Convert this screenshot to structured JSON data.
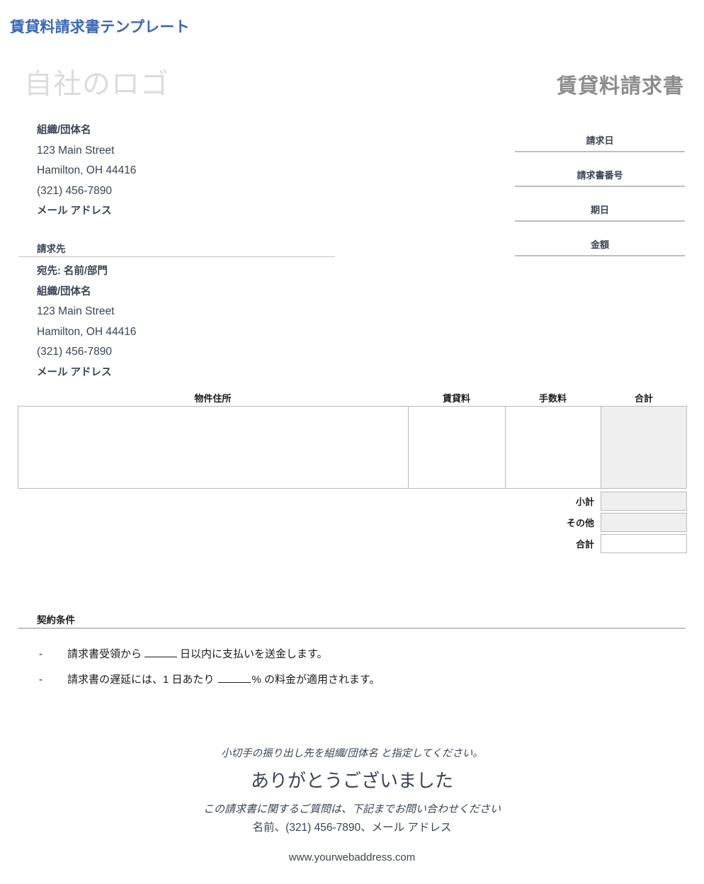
{
  "template_title": "賃貸料請求書テンプレート",
  "logo_placeholder": "自社のロゴ",
  "document_heading": "賃貸料請求書",
  "meta_fields": [
    {
      "label": "請求日",
      "value": ""
    },
    {
      "label": "請求書番号",
      "value": ""
    },
    {
      "label": "期日",
      "value": ""
    },
    {
      "label": "金額",
      "value": ""
    }
  ],
  "sender": {
    "lines": [
      {
        "text": "組織/団体名",
        "bold": true
      },
      {
        "text": "123 Main Street",
        "bold": false
      },
      {
        "text": "Hamilton, OH 44416",
        "bold": false
      },
      {
        "text": "(321) 456-7890",
        "bold": false
      },
      {
        "text": "メール アドレス",
        "bold": true
      }
    ]
  },
  "bill_to": {
    "heading": "請求先",
    "lines": [
      {
        "text": "宛先: 名前/部門",
        "bold": true
      },
      {
        "text": "組織/団体名",
        "bold": true
      },
      {
        "text": "123 Main Street",
        "bold": false
      },
      {
        "text": "Hamilton, OH 44416",
        "bold": false
      },
      {
        "text": "(321) 456-7890",
        "bold": false
      },
      {
        "text": "メール アドレス",
        "bold": true
      }
    ]
  },
  "items_table": {
    "columns": [
      "物件住所",
      "賃貸料",
      "手数料",
      "合計"
    ],
    "rows": [],
    "total_column_shaded_color": "#efefef"
  },
  "summary": [
    {
      "label": "小計",
      "value": "",
      "shaded": true
    },
    {
      "label": "その他",
      "value": "",
      "shaded": true
    },
    {
      "label": "合計",
      "value": "",
      "shaded": false
    }
  ],
  "terms": {
    "heading": "契約条件",
    "items": [
      {
        "marker": "-",
        "part1": "請求書受領から",
        "part2": "日以内に支払いを送金します。"
      },
      {
        "marker": "-",
        "part1": "請求書の遅延には、1 日あたり",
        "part2": "% の料金が適用されます。"
      }
    ]
  },
  "footer": {
    "payee_note": "小切手の振り出し先を組織/団体名 と指定してください。",
    "thanks": "ありがとうございました",
    "question_note": "この請求書に関するご質問は、下記までお問い合わせください",
    "contact": "名前、(321) 456-7890、メール アドレス",
    "url": "www.yourwebaddress.com"
  },
  "colors": {
    "title_blue": "#3a67b3",
    "logo_gray": "#dcdcdc",
    "heading_gray": "#8c8c8c",
    "text": "#3b4452",
    "rule": "#c3c3c3",
    "table_border": "#b9b9b9",
    "shade": "#efefef"
  }
}
